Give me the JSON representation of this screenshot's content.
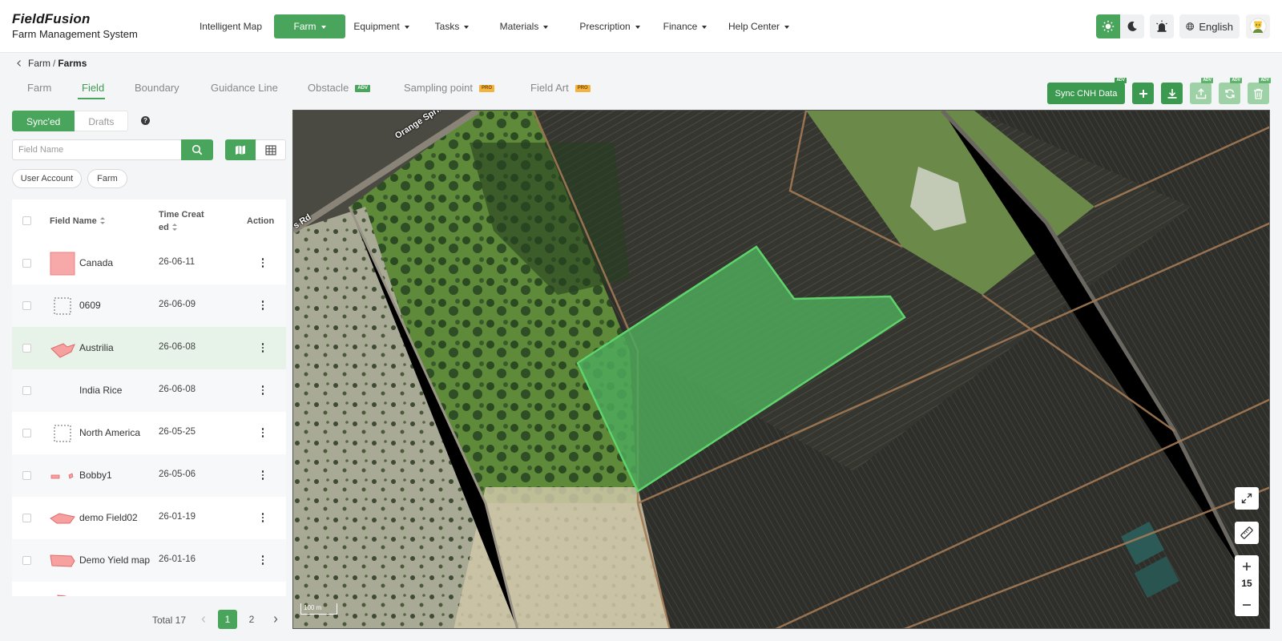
{
  "app": {
    "brand": "FieldFusion",
    "subtitle": "Farm Management System"
  },
  "nav": {
    "items": [
      {
        "label": "Intelligent Map",
        "dropdown": false,
        "active": false
      },
      {
        "label": "Farm",
        "dropdown": true,
        "active": true
      },
      {
        "label": "Equipment",
        "dropdown": true,
        "active": false
      },
      {
        "label": "Tasks",
        "dropdown": true,
        "active": false
      },
      {
        "label": "Materials",
        "dropdown": true,
        "active": false
      },
      {
        "label": "Prescription",
        "dropdown": true,
        "active": false
      },
      {
        "label": "Finance",
        "dropdown": true,
        "active": false
      },
      {
        "label": "Help Center",
        "dropdown": true,
        "active": false
      }
    ]
  },
  "topright": {
    "language": "English",
    "icons": [
      "sun-icon",
      "moon-icon",
      "alert-light-icon",
      "globe-icon",
      "user-avatar"
    ]
  },
  "breadcrumb": {
    "parent": "Farm",
    "separator": "/",
    "current": "Farms"
  },
  "tabs": [
    {
      "label": "Farm",
      "active": false,
      "badge": ""
    },
    {
      "label": "Field",
      "active": true,
      "badge": ""
    },
    {
      "label": "Boundary",
      "active": false,
      "badge": ""
    },
    {
      "label": "Guidance Line",
      "active": false,
      "badge": ""
    },
    {
      "label": "Obstacle",
      "active": false,
      "badge": "ADV"
    },
    {
      "label": "Sampling point",
      "active": false,
      "badge": "PRO"
    },
    {
      "label": "Field Art",
      "active": false,
      "badge": "PRO"
    }
  ],
  "toolbar": {
    "sync_label": "Sync CNH Data",
    "sync_badge": "ADV",
    "badge": "ADV"
  },
  "filter": {
    "segments": [
      "Sync'ed",
      "Drafts"
    ],
    "help": "?",
    "search_placeholder": "Field Name",
    "chips": [
      "User Account",
      "Farm"
    ]
  },
  "table": {
    "columns": {
      "name": "Field Name",
      "time_line1": "Time Creat",
      "time_line2": "ed",
      "action": "Action"
    },
    "rows": [
      {
        "name": "Canada",
        "date": "26-06-11",
        "thumb": "square",
        "selected": false
      },
      {
        "name": "0609",
        "date": "26-06-09",
        "thumb": "dashed",
        "selected": false
      },
      {
        "name": "Austrilia",
        "date": "26-06-08",
        "thumb": "poly1",
        "selected": true
      },
      {
        "name": "India Rice",
        "date": "26-06-08",
        "thumb": "none",
        "selected": false
      },
      {
        "name": "North America",
        "date": "26-05-25",
        "thumb": "dashed",
        "selected": false
      },
      {
        "name": "Bobby1",
        "date": "26-05-06",
        "thumb": "small",
        "selected": false
      },
      {
        "name": "demo Field02",
        "date": "26-01-19",
        "thumb": "poly2",
        "selected": false
      },
      {
        "name": "Demo Yield map",
        "date": "26-01-16",
        "thumb": "poly3",
        "selected": false
      }
    ]
  },
  "pagination": {
    "total": "Total 17",
    "pages": [
      "1",
      "2"
    ],
    "current": "1"
  },
  "map": {
    "road_labels": [
      "Orange Spring",
      "s Rd"
    ],
    "scale": "100 m",
    "zoom": "15",
    "highlight_color": "#5ed46c"
  }
}
